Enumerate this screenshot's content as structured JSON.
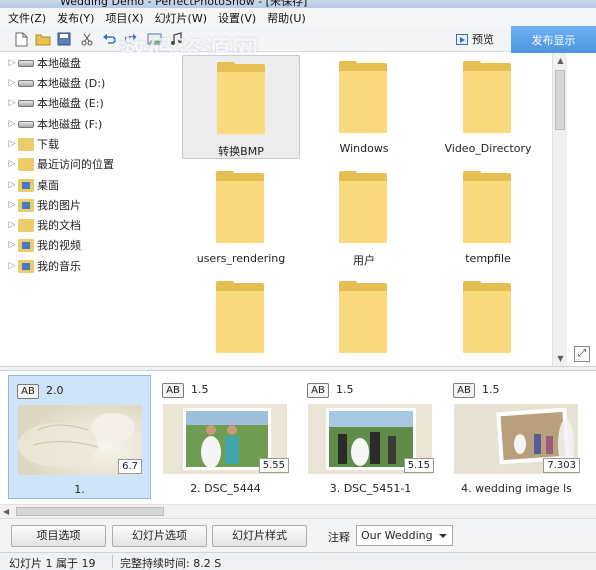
{
  "window": {
    "title": "Wedding Demo - PerfectPhotoShow - [未保存]"
  },
  "menu": [
    "文件(Z)",
    "发布(Y)",
    "项目(X)",
    "幻灯片(W)",
    "设置(V)",
    "帮助(U)"
  ],
  "toolbar": {
    "preview_label": "预览",
    "publish_label": "发布显示"
  },
  "watermark": {
    "text": "数码资源网",
    "url": "www.smzy.com"
  },
  "tree": [
    {
      "label": "本地磁盘",
      "icon": "drive-icon"
    },
    {
      "label": "本地磁盘 (D:)",
      "icon": "drive-icon"
    },
    {
      "label": "本地磁盘 (E:)",
      "icon": "drive-icon"
    },
    {
      "label": "本地磁盘 (F:)",
      "icon": "drive-icon"
    },
    {
      "label": "下载",
      "icon": "folder-icon"
    },
    {
      "label": "最近访问的位置",
      "icon": "folder-icon"
    },
    {
      "label": "桌面",
      "icon": "folder-icon"
    },
    {
      "label": "我的图片",
      "icon": "folder-icon"
    },
    {
      "label": "我的文档",
      "icon": "folder-icon"
    },
    {
      "label": "我的视频",
      "icon": "folder-icon"
    },
    {
      "label": "我的音乐",
      "icon": "folder-icon"
    }
  ],
  "files": [
    "转换BMP",
    "Windows",
    "Video_Directory",
    "users_rendering",
    "用户",
    "tempfile",
    "",
    "",
    ""
  ],
  "slides": [
    {
      "num": "2.0",
      "length": "6.7",
      "label": "1.",
      "ab": "AB"
    },
    {
      "num": "1.5",
      "length": "5.55",
      "label": "2. DSC_5444",
      "ab": "AB"
    },
    {
      "num": "1.5",
      "length": "5.15",
      "label": "3. DSC_5451-1",
      "ab": "AB"
    },
    {
      "num": "1.5",
      "length": "7.303",
      "label": "4. wedding image ls",
      "ab": "AB"
    }
  ],
  "buttons": {
    "project_options": "项目选项",
    "slide_options": "幻灯片选项",
    "slide_style": "幻灯片样式"
  },
  "note": {
    "label": "注释",
    "value": "Our Wedding"
  },
  "status": {
    "slide": "幻灯片 1 属于 19",
    "duration": "完整持续时间: 8.2 S"
  }
}
